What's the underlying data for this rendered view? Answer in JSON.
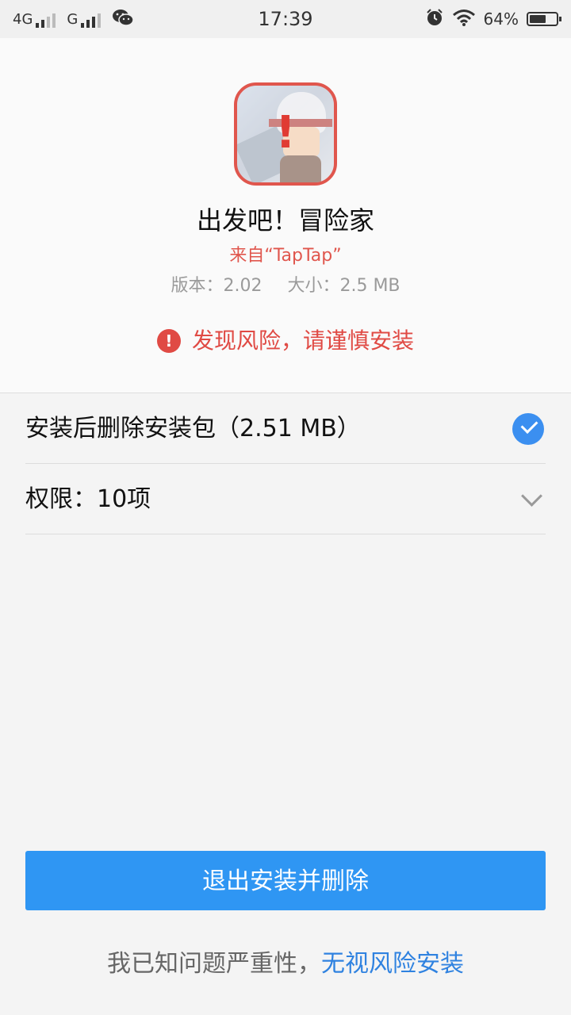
{
  "status_bar": {
    "network_1": "4G",
    "network_2": "G",
    "time": "17:39",
    "battery": "64%",
    "battery_level": 0.64,
    "icons": [
      "signal-icon",
      "wechat-icon",
      "alarm-icon",
      "wifi-icon",
      "battery-icon"
    ]
  },
  "app": {
    "icon": "app-icon-adventurer",
    "alert_mark": "!",
    "name": "出发吧！冒险家",
    "source": "来自“TapTap”",
    "version": "版本：2.02",
    "size": "大小：2.5 MB"
  },
  "risk": {
    "icon_glyph": "!",
    "text": "发现风险，请谨慎安装",
    "color": "#e04a44"
  },
  "options": {
    "delete_package": {
      "label": "安装后删除安装包（2.51 MB）",
      "checked": true
    },
    "permissions": {
      "label": "权限：10项",
      "expanded": false
    }
  },
  "actions": {
    "exit_label": "退出安装并删除",
    "ignore_prefix": "我已知问题严重性，",
    "ignore_link": "无视风险安装"
  },
  "colors": {
    "accent": "#2f96f3",
    "link": "#2f82e0",
    "danger": "#e0564d"
  }
}
